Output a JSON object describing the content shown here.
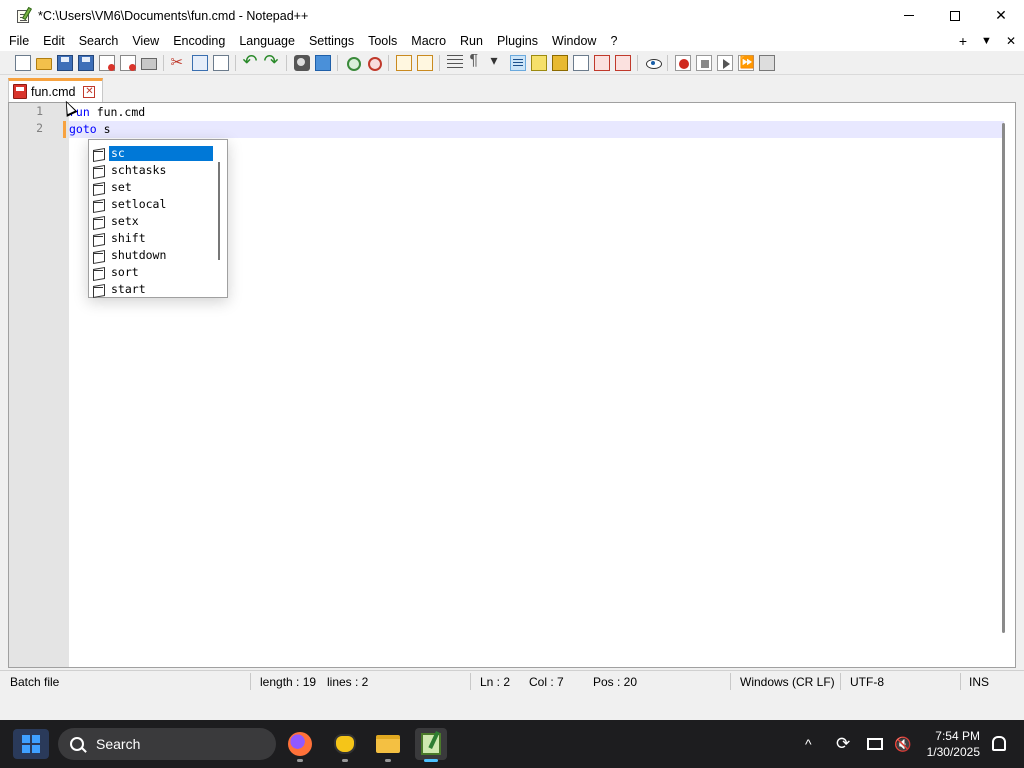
{
  "window": {
    "title": "*C:\\Users\\VM6\\Documents\\fun.cmd - Notepad++",
    "controls": {
      "minimize": "—",
      "maximize": "☐",
      "close": "✕"
    }
  },
  "menu": {
    "items": [
      "File",
      "Edit",
      "Search",
      "View",
      "Encoding",
      "Language",
      "Settings",
      "Tools",
      "Macro",
      "Run",
      "Plugins",
      "Window",
      "?"
    ],
    "right": {
      "plus": "+",
      "dropdown": "▼",
      "close": "✕"
    }
  },
  "tab": {
    "label": "fun.cmd",
    "close": "✕"
  },
  "editor": {
    "lines": [
      {
        "number": "1",
        "parts": [
          {
            "text": "run",
            "kw": true
          },
          {
            "text": " fun.cmd",
            "kw": false
          }
        ]
      },
      {
        "number": "2",
        "parts": [
          {
            "text": "goto",
            "kw": true
          },
          {
            "text": " s",
            "kw": false
          }
        ]
      }
    ]
  },
  "autocomplete": {
    "selected_index": 0,
    "items": [
      "sc",
      "schtasks",
      "set",
      "setlocal",
      "setx",
      "shift",
      "shutdown",
      "sort",
      "start"
    ]
  },
  "statusbar": {
    "language": "Batch file",
    "length": "length : 19",
    "lines": "lines : 2",
    "ln": "Ln : 2",
    "col": "Col : 7",
    "pos": "Pos : 20",
    "eol": "Windows (CR LF)",
    "encoding": "UTF-8",
    "mode": "INS"
  },
  "taskbar": {
    "search_label": "Search",
    "time": "7:54 PM",
    "date": "1/30/2025",
    "tray_chevron": "^"
  },
  "colors": {
    "keyword": "#0000ff",
    "tab_accent": "#f7a23f",
    "selection": "#0078d7",
    "current_line": "#e8e8ff"
  }
}
